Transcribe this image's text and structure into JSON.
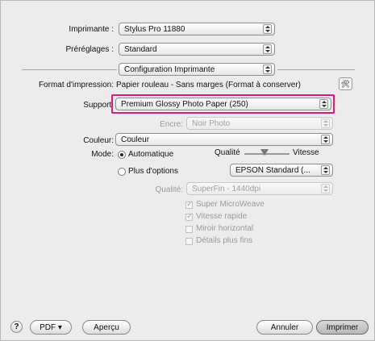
{
  "printer": {
    "label": "Imprimante :",
    "value": "Stylus Pro 11880"
  },
  "presets": {
    "label": "Préréglages :",
    "value": "Standard"
  },
  "panel": {
    "value": "Configuration Imprimante"
  },
  "page_format": {
    "label": "Format d'impression:",
    "value": "Papier rouleau - Sans marges (Format à conserver)"
  },
  "media": {
    "label": "Support:",
    "value": "Premium Glossy Photo Paper (250)"
  },
  "ink": {
    "label": "Encre:",
    "value": "Noir Photo"
  },
  "color": {
    "label": "Couleur:",
    "value": "Couleur"
  },
  "mode": {
    "label": "Mode:",
    "automatic": "Automatique",
    "more_options": "Plus d'options",
    "selected": "Automatique"
  },
  "quality_slider": {
    "left_label": "Qualité",
    "right_label": "Vitesse"
  },
  "epson_mode": {
    "value": "EPSON Standard (..."
  },
  "print_quality": {
    "label": "Qualité:",
    "value": "SuperFin - 1440dpi"
  },
  "checkboxes": [
    {
      "label": "Super MicroWeave",
      "checked": true
    },
    {
      "label": "Vitesse rapide",
      "checked": true
    },
    {
      "label": "Miroir horizontal",
      "checked": false
    },
    {
      "label": "Détails plus fins",
      "checked": false
    }
  ],
  "footer": {
    "help": "?",
    "pdf": "PDF ▾",
    "preview": "Aperçu",
    "cancel": "Annuler",
    "print": "Imprimer"
  },
  "colors": {
    "highlight": "#e0187c"
  }
}
